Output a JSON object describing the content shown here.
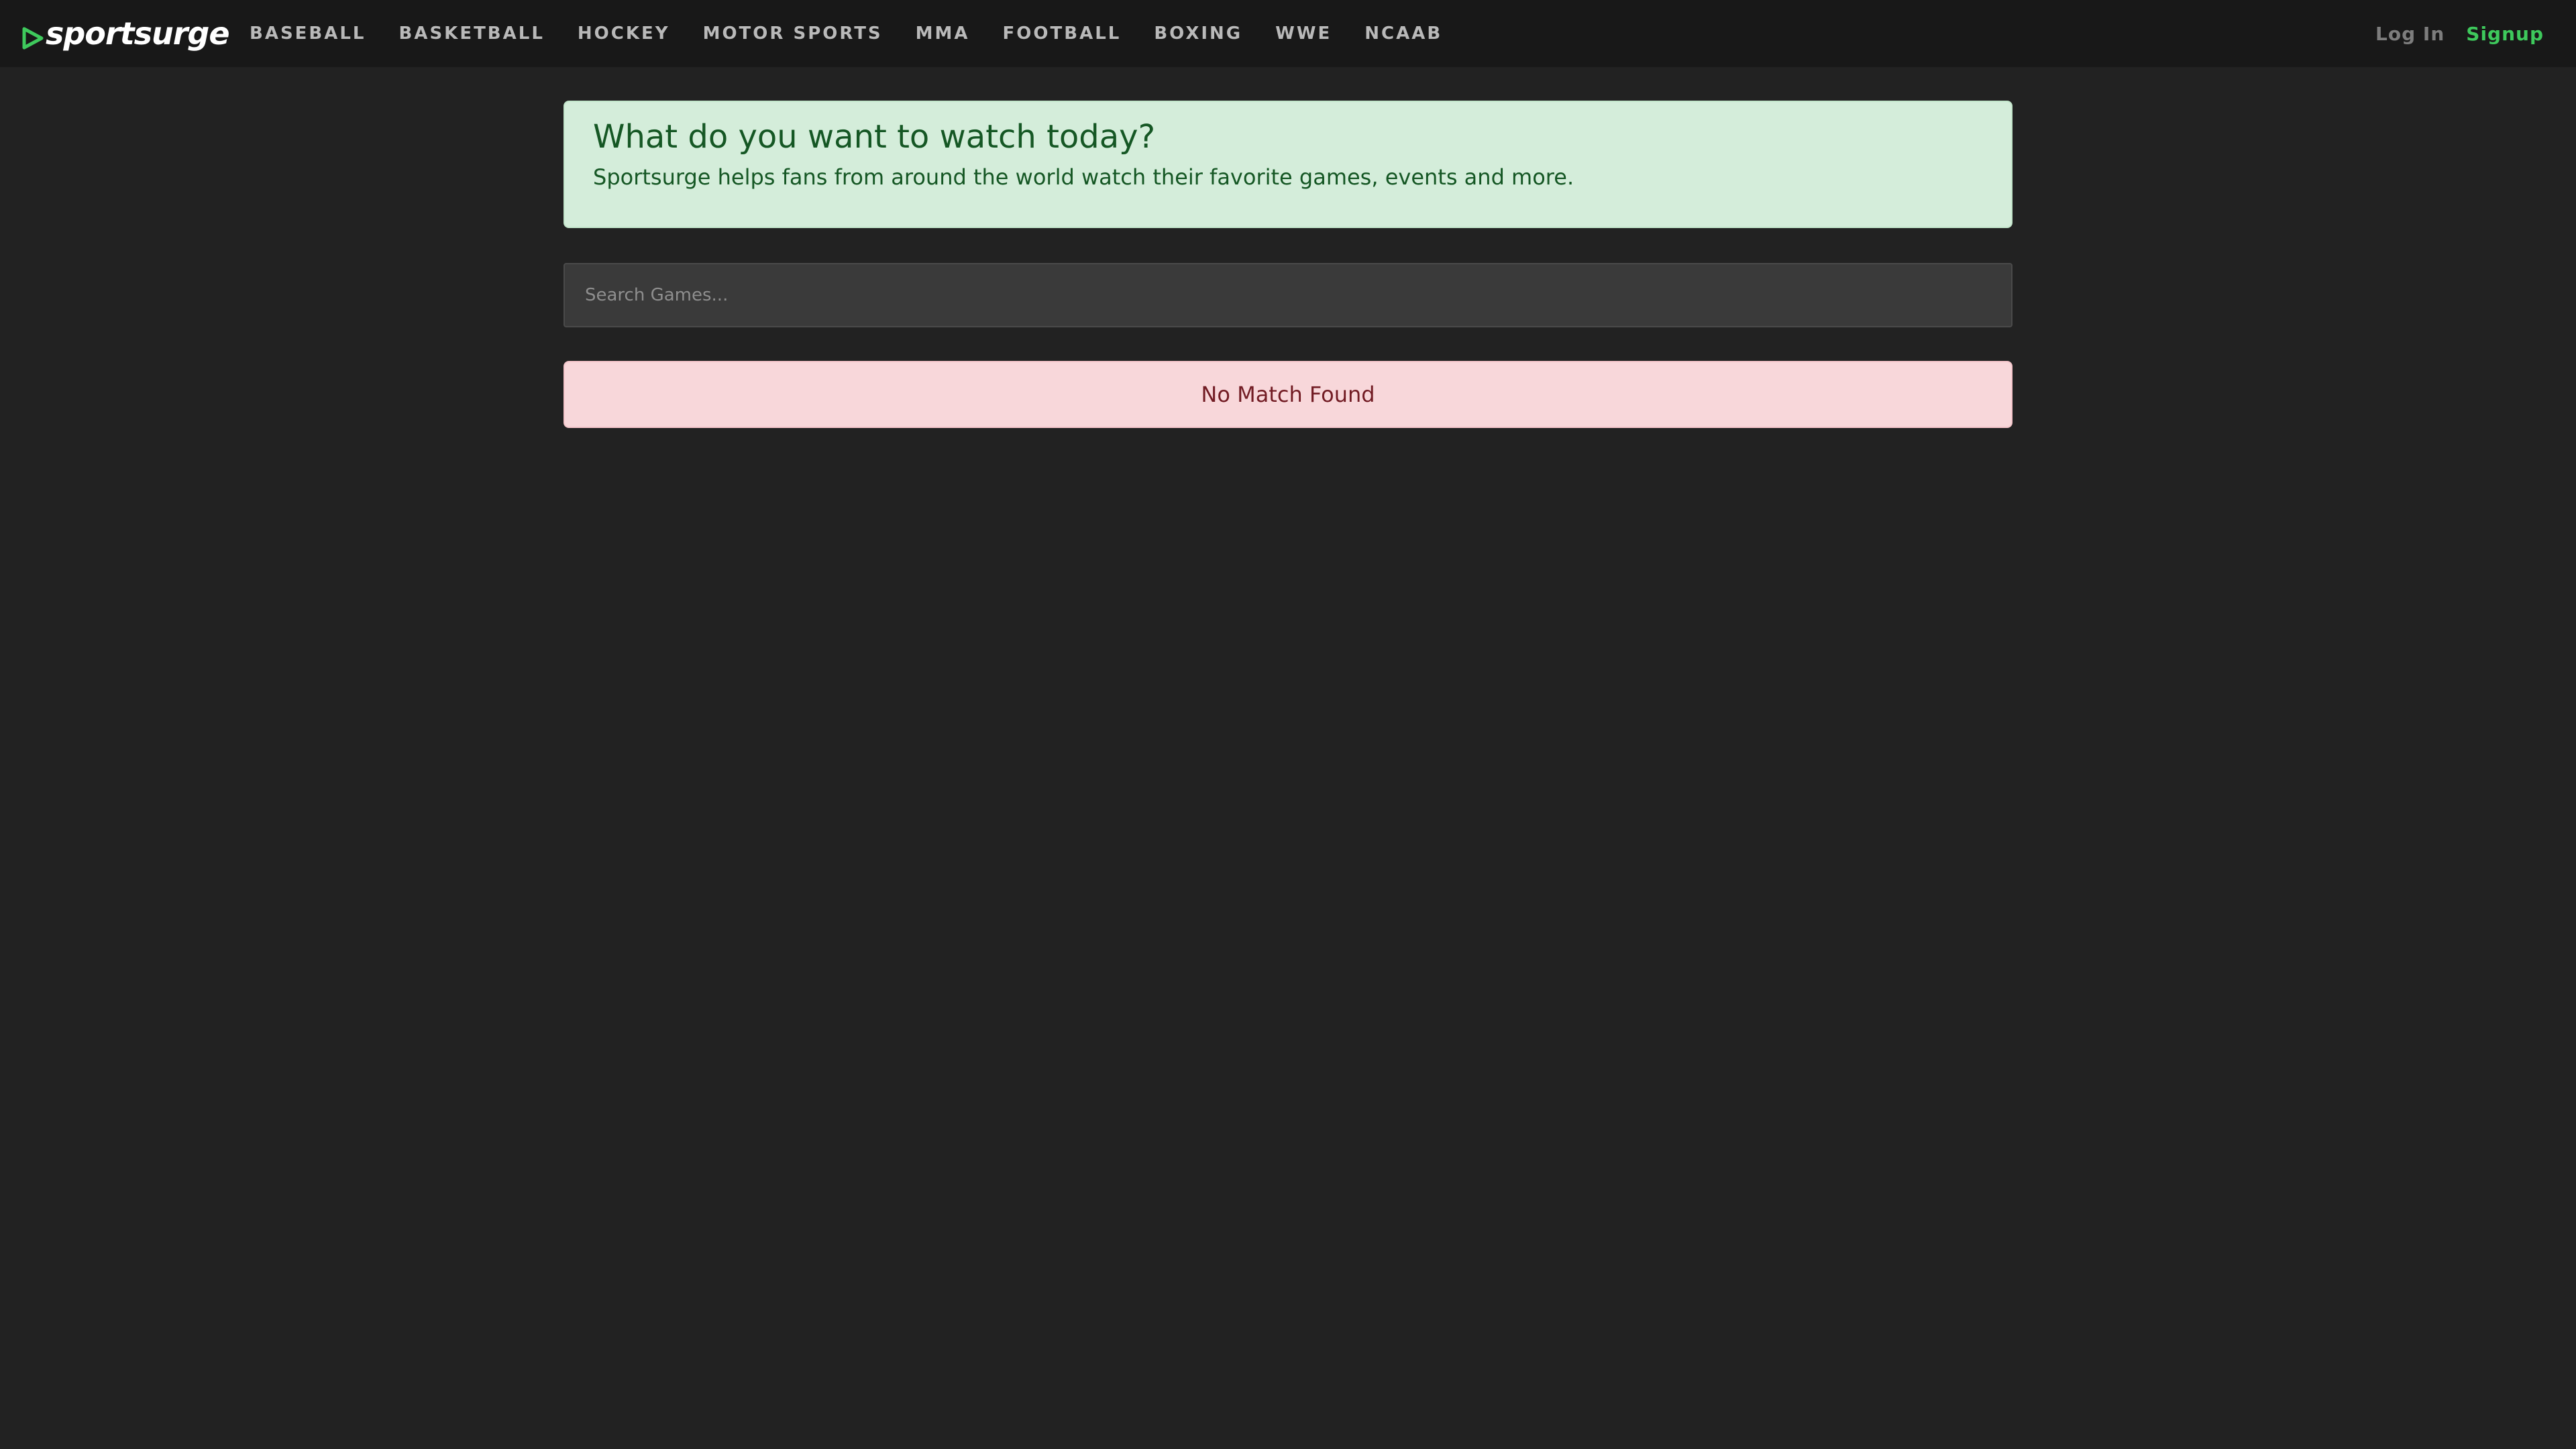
{
  "brand": {
    "name": "sportsurge",
    "icon": "play-triangle-icon",
    "accent": "#3ec95c"
  },
  "nav": {
    "items": [
      {
        "label": "BASEBALL"
      },
      {
        "label": "BASKETBALL"
      },
      {
        "label": "HOCKEY"
      },
      {
        "label": "MOTOR SPORTS"
      },
      {
        "label": "MMA"
      },
      {
        "label": "FOOTBALL"
      },
      {
        "label": "BOXING"
      },
      {
        "label": "WWE"
      },
      {
        "label": "NCAAB"
      }
    ]
  },
  "auth": {
    "login_label": "Log In",
    "signup_label": "Signup"
  },
  "hero": {
    "title": "What do you want to watch today?",
    "subtitle": "Sportsurge helps fans from around the world watch their favorite games, events and more."
  },
  "search": {
    "placeholder": "Search Games...",
    "value": ""
  },
  "results": {
    "message": "No Match Found"
  },
  "colors": {
    "background": "#222222",
    "navbar": "#181818",
    "hero_bg": "#d4edda",
    "hero_text": "#155724",
    "notice_bg": "#f8d7da",
    "notice_text": "#721c24"
  }
}
